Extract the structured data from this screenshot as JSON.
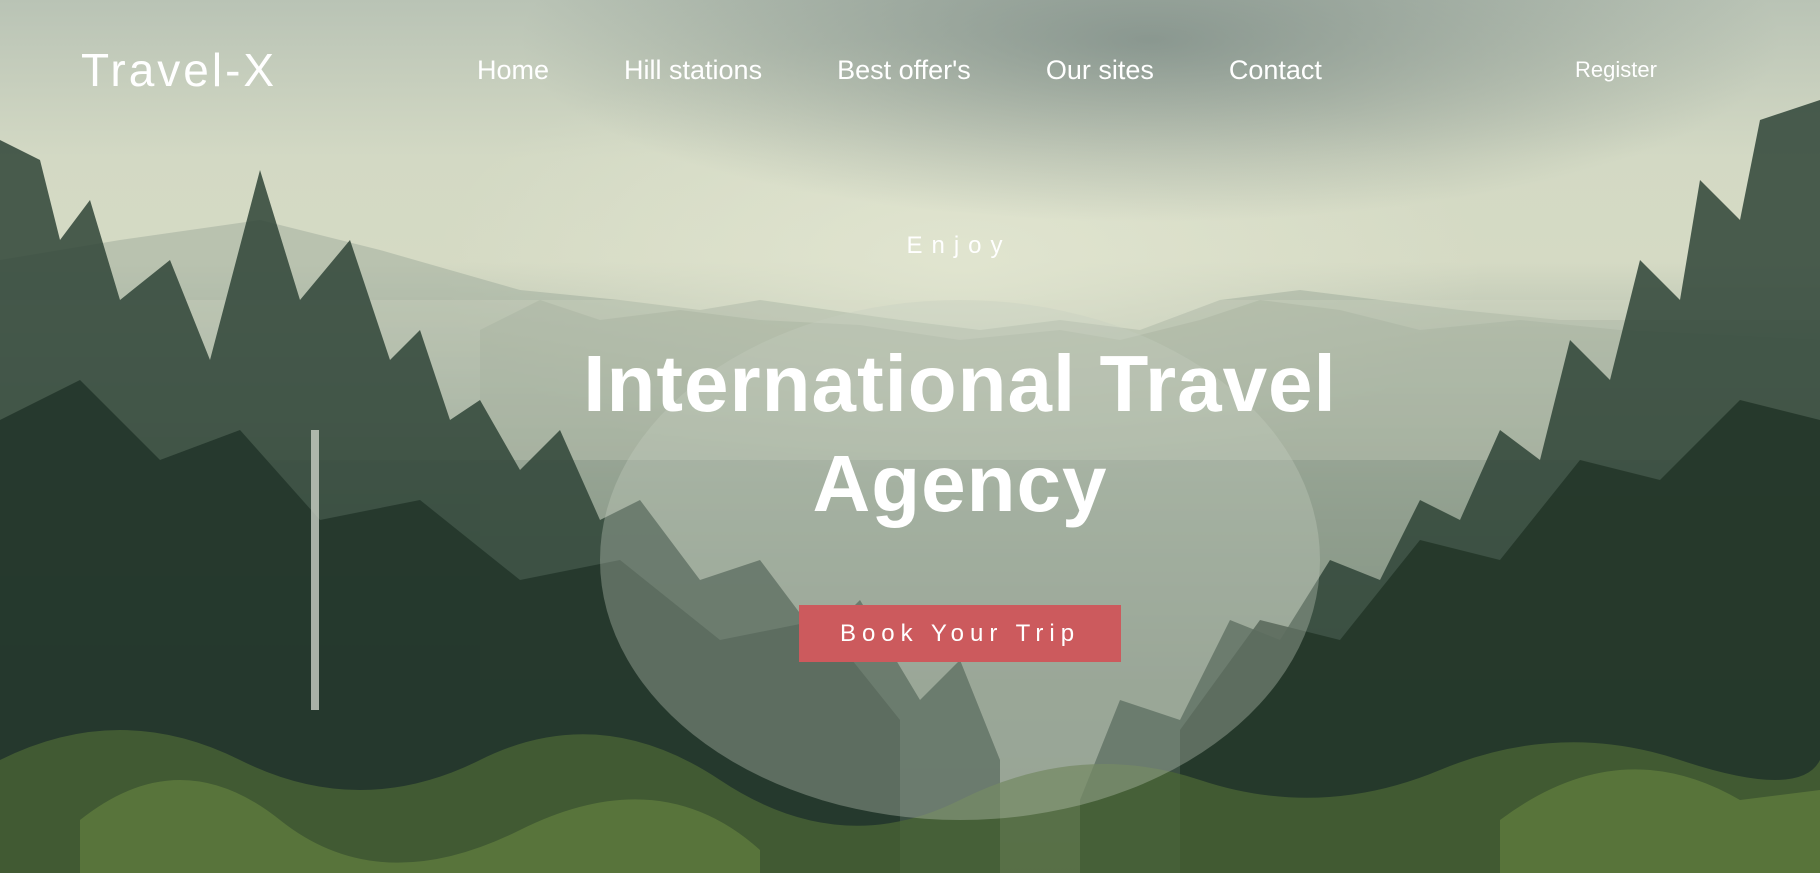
{
  "nav": {
    "logo": "Travel-X",
    "links": [
      {
        "label": "Home"
      },
      {
        "label": "Hill stations"
      },
      {
        "label": "Best offer's"
      },
      {
        "label": "Our sites"
      },
      {
        "label": "Contact"
      }
    ],
    "register_label": "Register"
  },
  "hero": {
    "eyebrow": "Enjoy",
    "headline": "International Travel Agency",
    "cta_label": "Book Your Trip",
    "background_image": "misty-pine-forest",
    "cta_color": "#cc5a5d"
  }
}
